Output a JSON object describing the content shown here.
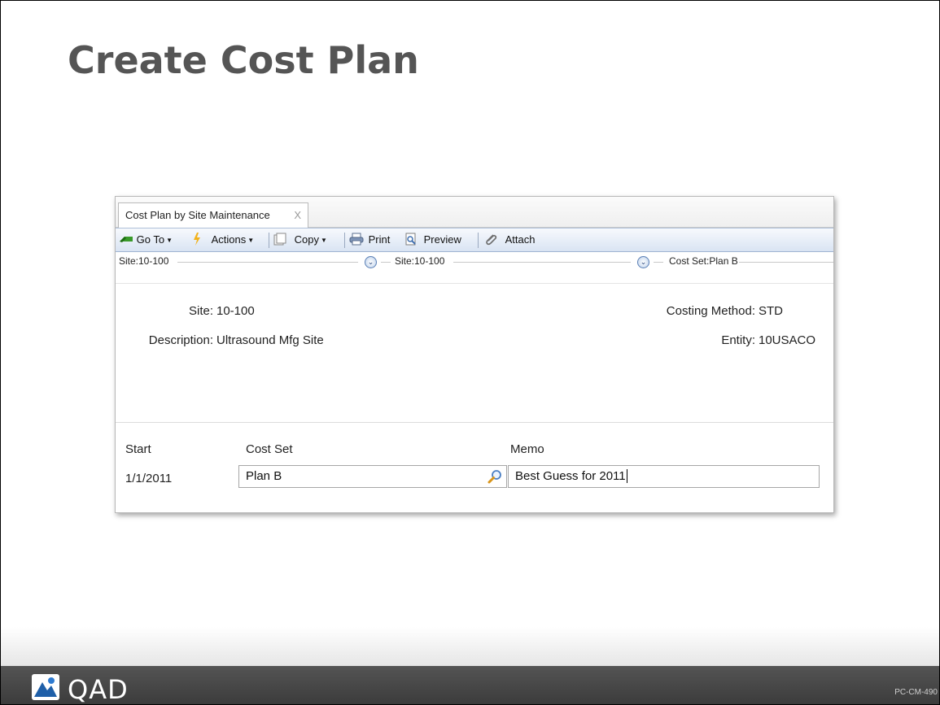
{
  "slide": {
    "title": "Create Cost Plan",
    "code": "PC-CM-490"
  },
  "window": {
    "tab_label": "Cost Plan by Site Maintenance",
    "tab_close": "X"
  },
  "toolbar": {
    "goto_label": "Go To",
    "actions_label": "Actions",
    "copy_label": "Copy",
    "print_label": "Print",
    "preview_label": "Preview",
    "attach_label": "Attach"
  },
  "breadcrumb": {
    "first": "Site:10-100",
    "second": "Site:10-100",
    "third": "Cost Set:Plan B"
  },
  "header": {
    "site_label": "Site:",
    "site_value": "10-100",
    "description_label": "Description:",
    "description_value": "Ultrasound Mfg Site",
    "costing_method_label": "Costing Method:",
    "costing_method_value": "STD",
    "entity_label": "Entity:",
    "entity_value": "10USACO"
  },
  "grid": {
    "columns": [
      "Start",
      "Cost Set",
      "Memo"
    ],
    "row": {
      "start": "1/1/2011",
      "cost_set": "Plan B",
      "memo": "Best Guess for 2011"
    }
  },
  "brand": {
    "logo_text": "QAD",
    "accent": "#1f5fa8"
  }
}
